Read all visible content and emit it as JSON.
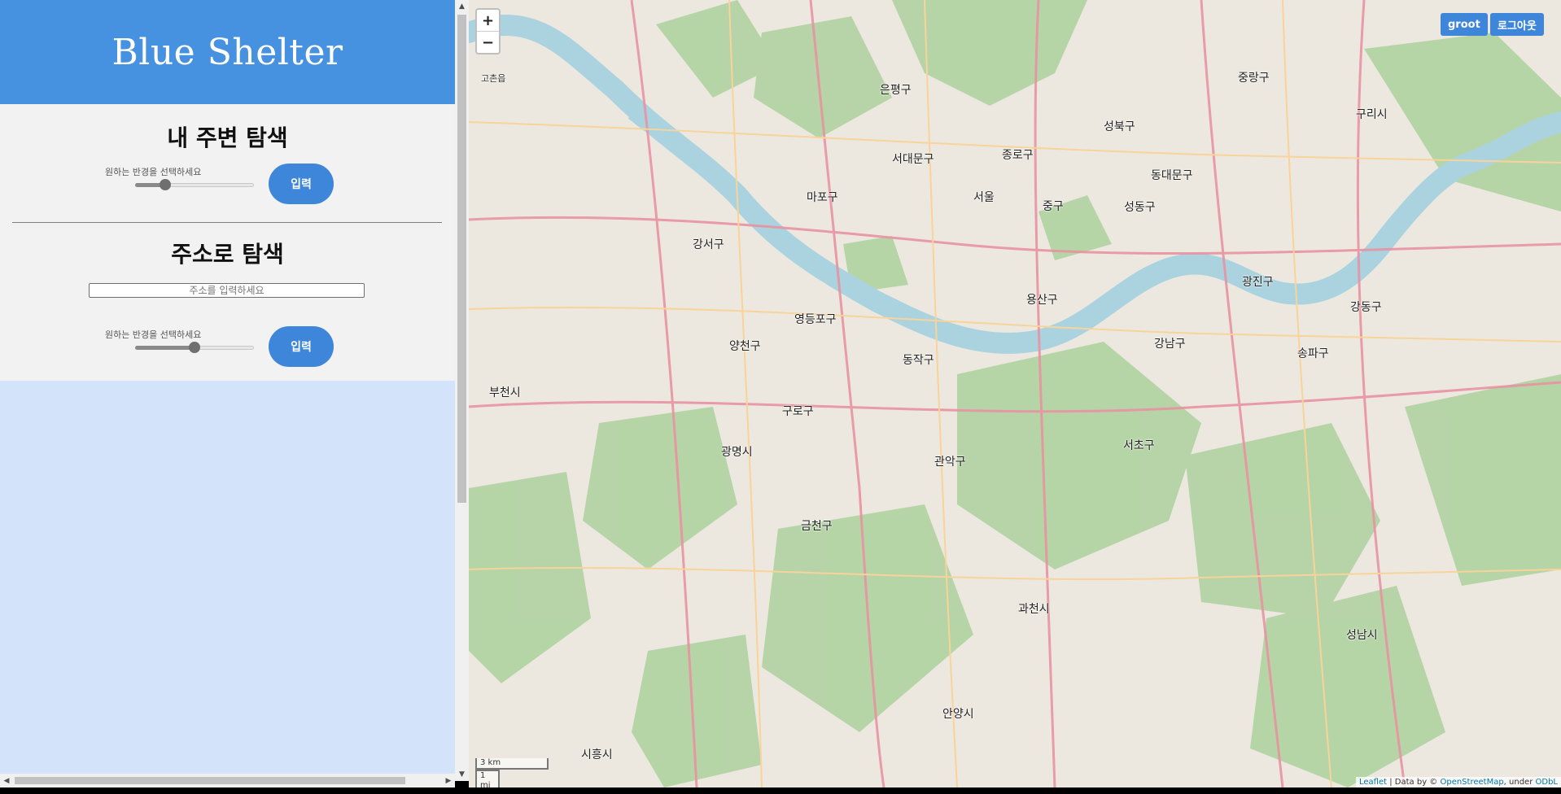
{
  "app": {
    "title": "Blue Shelter"
  },
  "nearby": {
    "title": "내 주변 탐색",
    "radius_label": "원하는 반경을 선택하세요",
    "radius_value": 0.25,
    "button": "입력"
  },
  "address": {
    "title": "주소로 탐색",
    "input_placeholder": "주소를 입력하세요",
    "input_value": "",
    "radius_label": "원하는 반경을 선택하세요",
    "radius_value": 0.5,
    "button": "입력"
  },
  "map": {
    "zoom_in": "+",
    "zoom_out": "−",
    "user_button": "groot",
    "logout_button": "로그아웃",
    "scale_km": "3 km",
    "scale_mi": "1 mi",
    "attribution": {
      "leaflet": "Leaflet",
      "sep": " | Data by © ",
      "osm": "OpenStreetMap",
      "under": ", under ",
      "odbl": "ODbL"
    },
    "places": {
      "mapo": "마포구",
      "seodaemun": "서대문구",
      "jongno": "종로구",
      "seongbuk": "성북구",
      "dongdaemun": "동대문구",
      "jungnang": "중랑구",
      "eunpyeong": "은평구",
      "seoul": "서울",
      "junggu": "중구",
      "seongdong": "성동구",
      "gwangjin": "광진구",
      "guri": "구리시",
      "gangseo": "강서구",
      "yangcheon": "양천구",
      "yeongdeungpo": "영등포구",
      "yongsan": "용산구",
      "gangnam": "강남구",
      "songpa": "송파구",
      "gangdong": "강동구",
      "bucheon": "부천시",
      "guro": "구로구",
      "dongjak": "동작구",
      "gwanak": "관악구",
      "seocho": "서초구",
      "gwangmyeong": "광명시",
      "geumcheon": "금천구",
      "gwacheon": "과천시",
      "seongnam": "성남시",
      "anyang": "안양시",
      "siheung": "시흥시",
      "gochon": "고촌읍"
    }
  },
  "colors": {
    "header": "#4791e1",
    "panel": "#f1f2f1",
    "sidebar_bg": "#d3e3f9",
    "button": "#3e86d9",
    "river": "#aad3df",
    "forest": "#add19e"
  }
}
